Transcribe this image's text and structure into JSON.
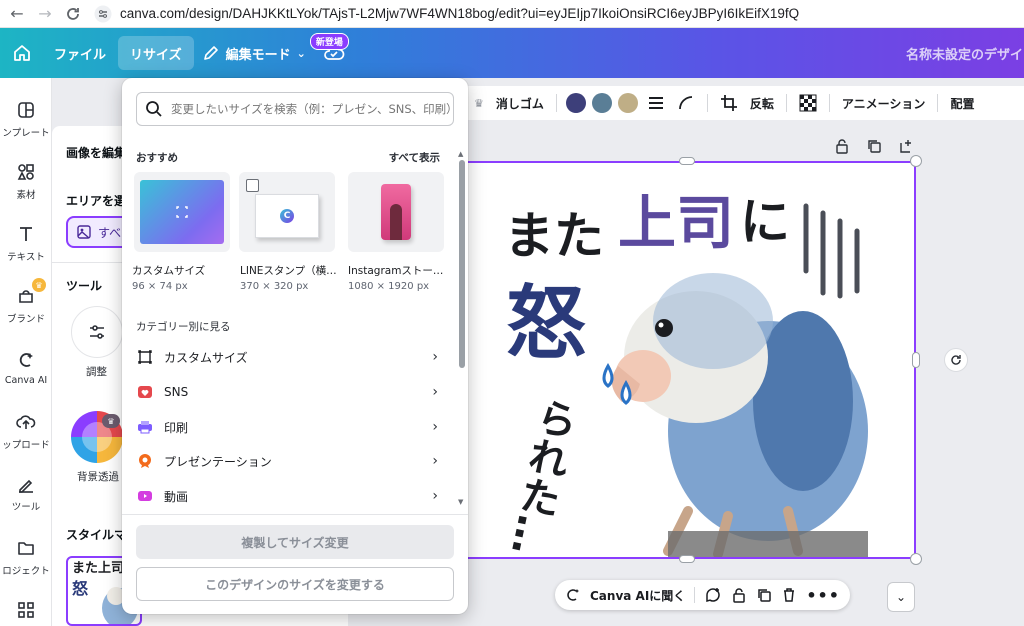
{
  "browser": {
    "url": "canva.com/design/DAHJKKtLYok/TAjsT-L2Mjw7WF4WN18bog/edit?ui=eyJEIjp7IkoiOnsiRCI6eyJBPyI6IkEifX19fQ"
  },
  "topbar": {
    "file_label": "ファイル",
    "resize_label": "リサイズ",
    "edit_mode_label": "編集モード",
    "new_badge": "新登場",
    "design_title": "名称未設定のデザイン"
  },
  "rail": {
    "items": [
      {
        "label": "ンプレート",
        "icon": "template-icon"
      },
      {
        "label": "素材",
        "icon": "elements-icon"
      },
      {
        "label": "テキスト",
        "icon": "text-icon"
      },
      {
        "label": "ブランド",
        "icon": "brand-icon"
      },
      {
        "label": "Canva AI",
        "icon": "canva-ai-icon"
      },
      {
        "label": "ップロード",
        "icon": "upload-icon"
      },
      {
        "label": "ツール",
        "icon": "tools-icon"
      },
      {
        "label": "ロジェクト",
        "icon": "folder-icon"
      },
      {
        "label": "",
        "icon": "apps-icon"
      }
    ]
  },
  "panel": {
    "edit_image": "画像を編集",
    "area_select": "エリアを選",
    "all_pill": "すべ",
    "tools_heading": "ツール",
    "adjust_label": "調整",
    "bg_remove_label": "背景透過",
    "style_heading": "スタイルマ"
  },
  "toolbar": {
    "eraser": "消しゴム",
    "flip": "反転",
    "animation": "アニメーション",
    "arrange": "配置",
    "colors": [
      "#3d3f7a",
      "#5a7e96",
      "#bfae86"
    ]
  },
  "dropdown": {
    "search_placeholder": "変更したいサイズを検索（例：プレゼン、SNS、印刷）",
    "recommended_heading": "おすすめ",
    "show_all": "すべて表示",
    "recommended": [
      {
        "name": "カスタムサイズ",
        "size": "96 × 74 px"
      },
      {
        "name": "LINEスタンプ（横…",
        "size": "370 × 320 px"
      },
      {
        "name": "Instagramストー…",
        "size": "1080 × 1920 px"
      }
    ],
    "category_heading": "カテゴリー別に見る",
    "categories": [
      {
        "label": "カスタムサイズ",
        "icon": "crop-icon",
        "color": "#1b1d21"
      },
      {
        "label": "SNS",
        "icon": "heart-icon",
        "color": "#e5484d"
      },
      {
        "label": "印刷",
        "icon": "printer-icon",
        "color": "#7d5cff"
      },
      {
        "label": "プレゼンテーション",
        "icon": "award-icon",
        "color": "#f36b1c"
      },
      {
        "label": "動画",
        "icon": "video-icon",
        "color": "#d43de0"
      }
    ],
    "copy_resize_btn": "複製してサイズ変更",
    "resize_this_btn": "このデザインのサイズを変更する"
  },
  "artwork": {
    "line1_a": "また",
    "line1_b": "上司",
    "line1_c": "に",
    "line2": "怒",
    "line3": "られた…"
  },
  "bottom_bar": {
    "ask_ai": "Canva AIに聞く"
  }
}
